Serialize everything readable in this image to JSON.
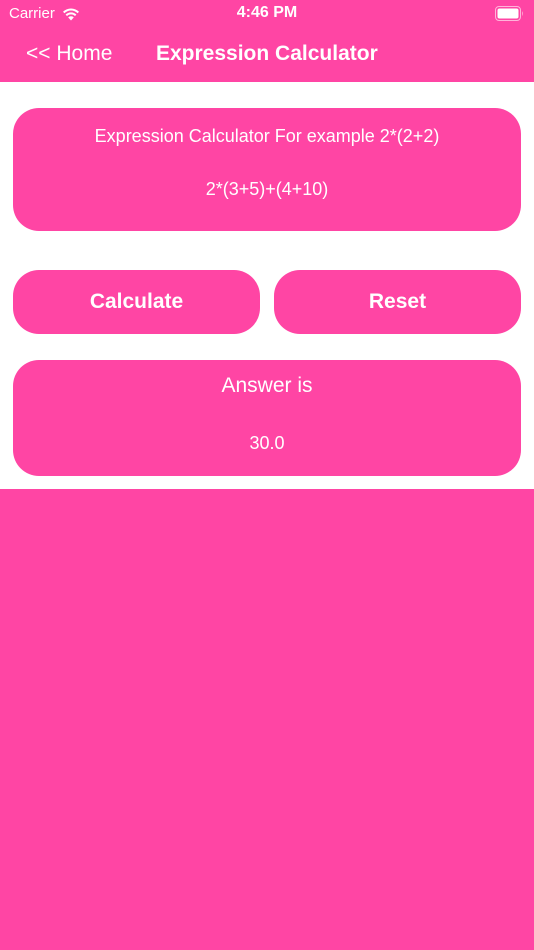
{
  "status_bar": {
    "carrier": "Carrier",
    "time": "4:46 PM"
  },
  "nav": {
    "back_label": "<< Home",
    "title": "Expression Calculator"
  },
  "expression": {
    "hint": "Expression Calculator For example 2*(2+2)",
    "value": "2*(3+5)+(4+10)"
  },
  "buttons": {
    "calculate": "Calculate",
    "reset": "Reset"
  },
  "answer": {
    "label": "Answer is",
    "value": "30.0"
  },
  "colors": {
    "primary": "#ff45a4",
    "content_bg": "#ffffff",
    "text": "#ffffff",
    "caret": "#3a5bff"
  }
}
